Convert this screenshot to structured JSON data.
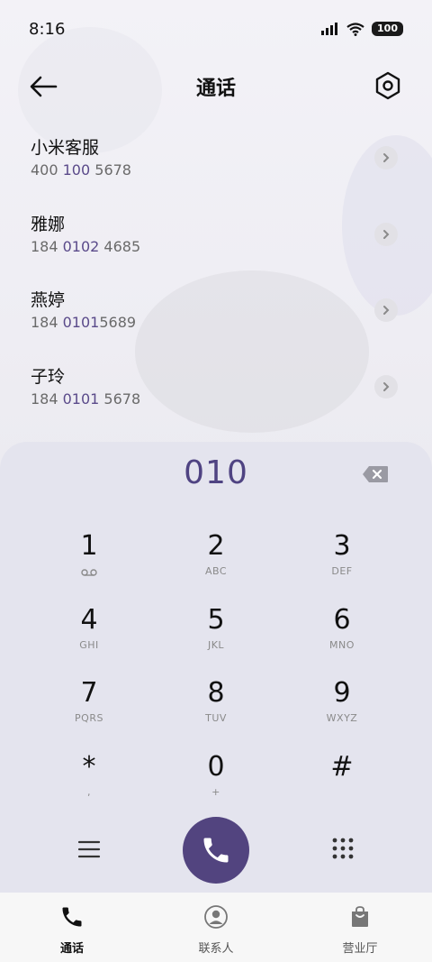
{
  "status_bar": {
    "time": "8:16",
    "battery": "100"
  },
  "header": {
    "title": "通话",
    "back_icon": "arrow-left-icon",
    "settings_icon": "hex-settings-icon"
  },
  "contacts": [
    {
      "name": "小米客服",
      "num_pre": "400 ",
      "num_hl": "100",
      "num_post": " 5678"
    },
    {
      "name": "雅娜",
      "num_pre": "184 ",
      "num_hl": "0102",
      "num_post": " 4685"
    },
    {
      "name": "燕婷",
      "num_pre": "184 ",
      "num_hl": "0101",
      "num_post": "5689"
    },
    {
      "name": "子玲",
      "num_pre": "184 ",
      "num_hl": "0101",
      "num_post": " 5678"
    }
  ],
  "dialpad": {
    "display": "010",
    "keys": [
      {
        "digit": "1",
        "letters": ""
      },
      {
        "digit": "2",
        "letters": "ABC"
      },
      {
        "digit": "3",
        "letters": "DEF"
      },
      {
        "digit": "4",
        "letters": "GHI"
      },
      {
        "digit": "5",
        "letters": "JKL"
      },
      {
        "digit": "6",
        "letters": "MNO"
      },
      {
        "digit": "7",
        "letters": "PQRS"
      },
      {
        "digit": "8",
        "letters": "TUV"
      },
      {
        "digit": "9",
        "letters": "WXYZ"
      },
      {
        "digit": "*",
        "letters": ","
      },
      {
        "digit": "0",
        "letters": "+"
      },
      {
        "digit": "#",
        "letters": ""
      }
    ]
  },
  "bottom_nav": {
    "calls": "通话",
    "contacts": "联系人",
    "store": "营业厅"
  },
  "colors": {
    "accent": "#52447f",
    "highlight": "#5a4a8a"
  }
}
